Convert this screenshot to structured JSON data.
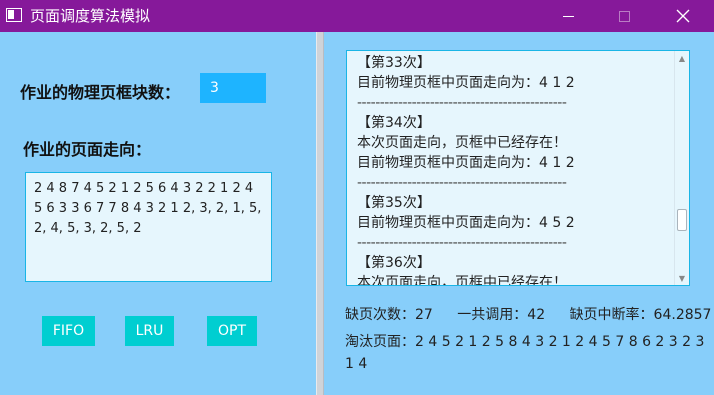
{
  "window": {
    "title": "页面调度算法模拟"
  },
  "left": {
    "frame_label": "作业的物理页框块数：",
    "frame_value": "3",
    "sequence_label": "作业的页面走向：",
    "sequence_value": "2 4 8 7 4 5 2 1 2 5 6 4 3 2 2 1 2 4 5 6 3 3 6 7 7 8 4 3 2 1 2, 3, 2, 1, 5, 2, 4, 5, 3, 2, 5, 2",
    "buttons": {
      "fifo": "FIFO",
      "lru": "LRU",
      "opt": "OPT"
    }
  },
  "log": {
    "lines": [
      "【第33次】",
      "目前物理页框中页面走向为：4 1 2",
      "----------------------------------------------",
      "【第34次】",
      "本次页面走向，页框中已经存在！",
      "目前物理页框中页面走向为：4 1 2",
      "----------------------------------------------",
      "【第35次】",
      "目前物理页框中页面走向为：4 5 2",
      "----------------------------------------------",
      "【第36次】",
      "本次页面走向，页框中已经存在！"
    ]
  },
  "stats": {
    "faults_label": "缺页次数：27",
    "calls_label": "一共调用：42",
    "rate_label": "缺页中断率：64.2857",
    "evicted": "淘汰页面：2 4 5 2 1 2 5 8 4 3 2 1 2 4 5 7 8 6 2 3 2 3 1 4"
  }
}
